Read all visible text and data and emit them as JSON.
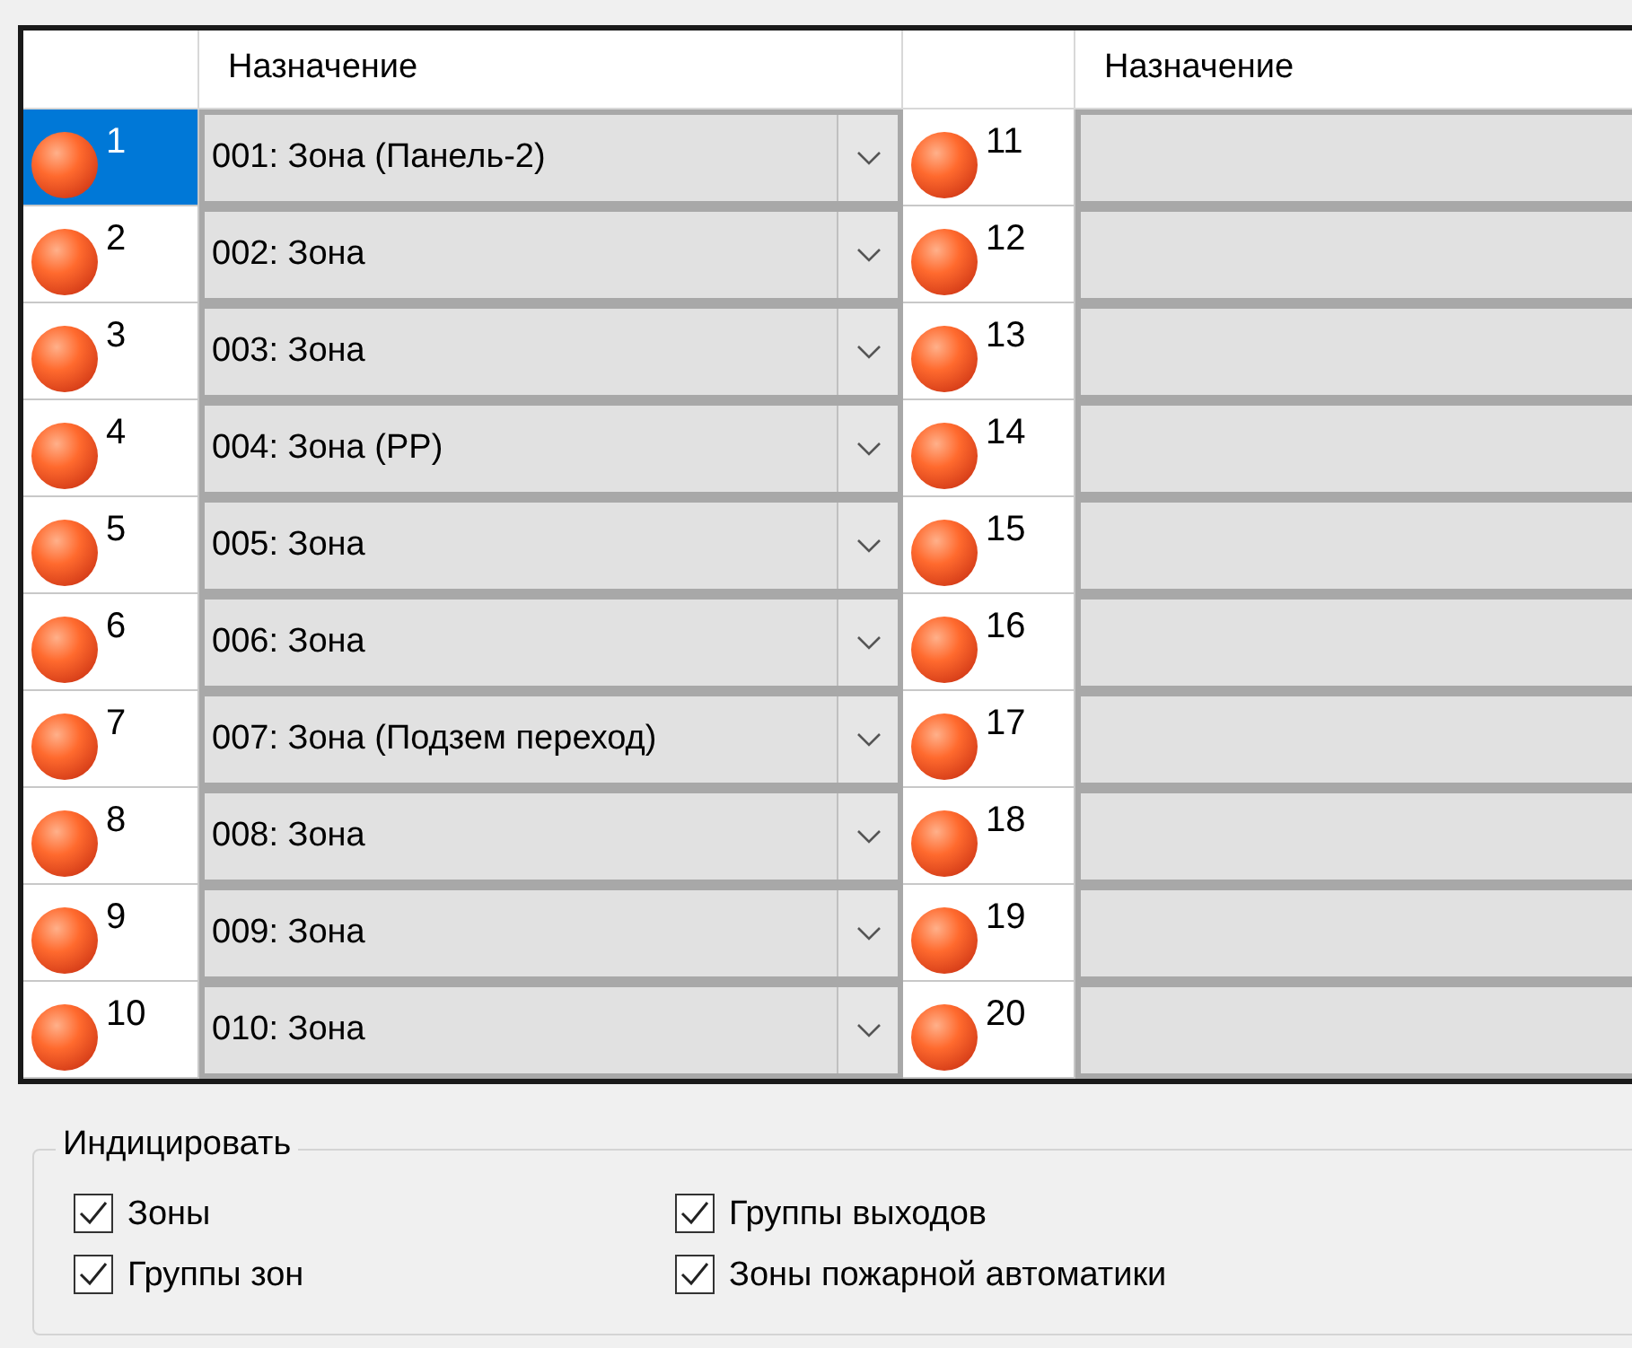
{
  "table": {
    "columns": [
      {
        "kind": "number"
      },
      {
        "kind": "text",
        "label": "Назначение"
      },
      {
        "kind": "number"
      },
      {
        "kind": "text",
        "label": "Назначение"
      }
    ],
    "left_rows": [
      {
        "number": "1",
        "selected": true,
        "value": "001: Зона (Панель-2)"
      },
      {
        "number": "2",
        "selected": false,
        "value": "002: Зона"
      },
      {
        "number": "3",
        "selected": false,
        "value": "003: Зона"
      },
      {
        "number": "4",
        "selected": false,
        "value": "004: Зона (РР)"
      },
      {
        "number": "5",
        "selected": false,
        "value": "005: Зона"
      },
      {
        "number": "6",
        "selected": false,
        "value": "006: Зона"
      },
      {
        "number": "7",
        "selected": false,
        "value": "007: Зона (Подзем переход)"
      },
      {
        "number": "8",
        "selected": false,
        "value": "008: Зона"
      },
      {
        "number": "9",
        "selected": false,
        "value": "009: Зона"
      },
      {
        "number": "10",
        "selected": false,
        "value": "010: Зона"
      }
    ],
    "right_rows": [
      {
        "number": "11",
        "selected": false
      },
      {
        "number": "12",
        "selected": false
      },
      {
        "number": "13",
        "selected": false
      },
      {
        "number": "14",
        "selected": false
      },
      {
        "number": "15",
        "selected": false
      },
      {
        "number": "16",
        "selected": false
      },
      {
        "number": "17",
        "selected": false
      },
      {
        "number": "18",
        "selected": false
      },
      {
        "number": "19",
        "selected": false
      },
      {
        "number": "20",
        "selected": false
      }
    ]
  },
  "indicate": {
    "title": "Индицировать",
    "options": [
      {
        "label": "Зоны",
        "checked": true
      },
      {
        "label": "Группы выходов",
        "checked": true
      },
      {
        "label": "Группы зон",
        "checked": true
      },
      {
        "label": "Зоны пожарной автоматики",
        "checked": true
      }
    ]
  }
}
